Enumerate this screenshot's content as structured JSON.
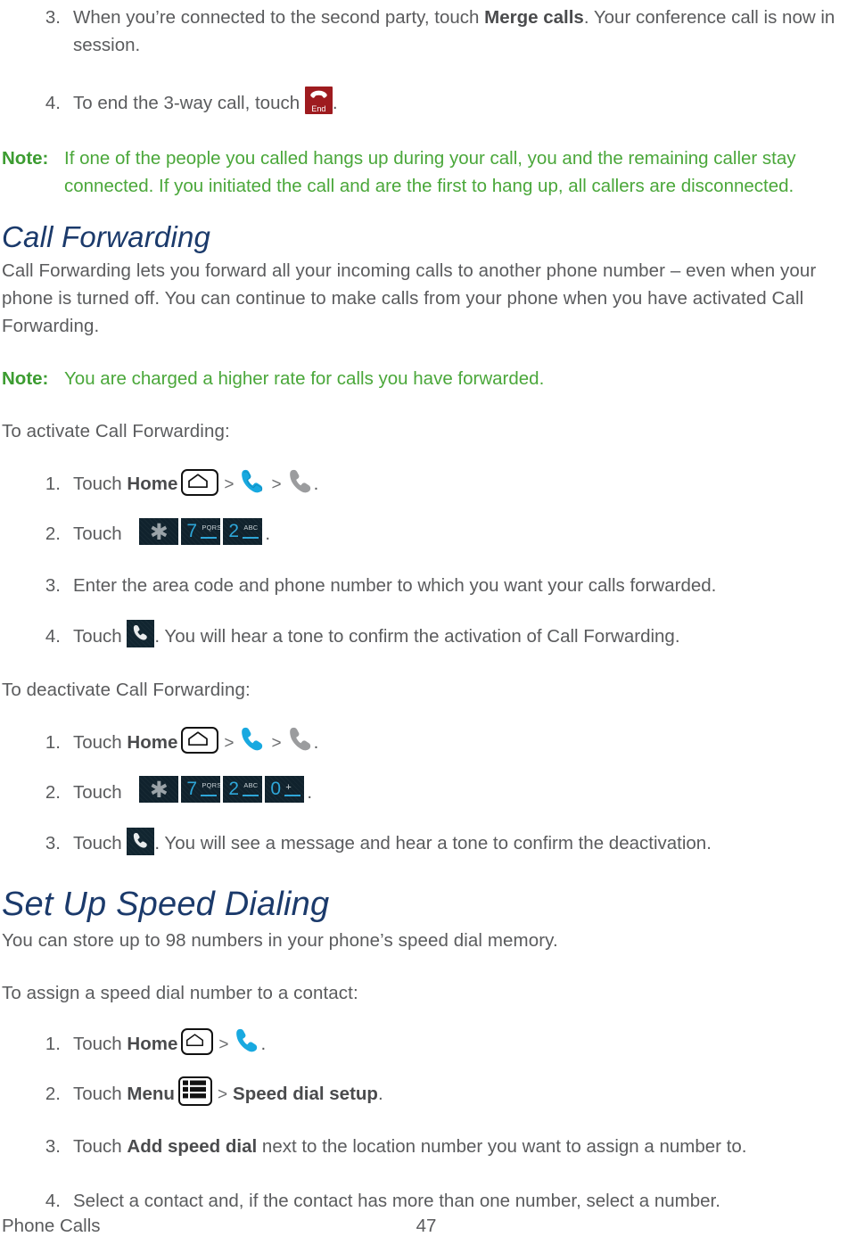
{
  "page": {
    "footer_section": "Phone Calls",
    "footer_page_number": "47"
  },
  "colors": {
    "heading": "#1b3a6b",
    "body": "#5a5b5d",
    "note": "#4aa73a",
    "note_label": "#3c9c31",
    "end_key": "#9e1b1f",
    "dialpad_key_bg": "#10222d",
    "dialpad_glyph": "#2ea6d8",
    "phone_blue": "#18a9e0"
  },
  "three_way": {
    "step3": {
      "num": "3.",
      "text_before": "When you’re connected to the second party, touch ",
      "bold": "Merge calls",
      "text_after": ". Your conference call is now in session."
    },
    "step4": {
      "num": "4.",
      "text_before": "To end the 3-way call, touch ",
      "text_after": "."
    },
    "note": {
      "label": "Note:",
      "text": "If one of the people you called hangs up during your call, you and the remaining caller stay connected. If you initiated the call and are the first to hang up, all callers are disconnected."
    }
  },
  "icons": {
    "end_key_label": "End",
    "home_key": "home-key-icon",
    "menu_key": "menu-key-icon",
    "call_key": "call-key-icon",
    "phone_blue": "phone-handset-blue-icon",
    "phone_gray": "phone-handset-gray-icon",
    "separator": ">"
  },
  "dialpad_keys": {
    "star": {
      "glyph": "✱",
      "sub": ""
    },
    "seven": {
      "glyph": "7",
      "sub": "PQRS"
    },
    "two": {
      "glyph": "2",
      "sub": "ABC"
    },
    "zero": {
      "glyph": "0",
      "sub": "+"
    }
  },
  "call_forwarding": {
    "heading": "Call Forwarding",
    "intro": "Call Forwarding lets you forward all your incoming calls to another phone number – even when your phone is turned off. You can continue to make calls from your phone when you have activated Call Forwarding.",
    "note": {
      "label": "Note:",
      "text": "You are charged a higher rate for calls you have forwarded."
    },
    "activate_lead": "To activate Call Forwarding:",
    "activate_steps": [
      {
        "num": "1.",
        "text_before": "Touch ",
        "bold": "Home",
        "text_after": "."
      },
      {
        "num": "2.",
        "text_before": "Touch ",
        "text_after": "."
      },
      {
        "num": "3.",
        "text": "Enter the area code and phone number to which you want your calls forwarded."
      },
      {
        "num": "4.",
        "text_before": "Touch ",
        "text_after": ". You will hear a tone to confirm the activation of Call Forwarding."
      }
    ],
    "deactivate_lead": "To deactivate Call Forwarding:",
    "deactivate_steps": [
      {
        "num": "1.",
        "text_before": "Touch ",
        "bold": "Home",
        "text_after": "."
      },
      {
        "num": "2.",
        "text_before": "Touch ",
        "text_after": "."
      },
      {
        "num": "3.",
        "text_before": "Touch ",
        "text_after": ". You will see a message and hear a tone to confirm the deactivation."
      }
    ]
  },
  "speed_dialing": {
    "heading": "Set Up Speed Dialing",
    "intro": "You can store up to 98 numbers in your phone’s speed dial memory.",
    "assign_lead": "To assign a speed dial number to a contact:",
    "steps": [
      {
        "num": "1.",
        "text_before": "Touch ",
        "bold": "Home",
        "text_after": "."
      },
      {
        "num": "2.",
        "text_before": "Touch ",
        "bold": "Menu",
        "bold2": "Speed dial setup",
        "text_after": "."
      },
      {
        "num": "3.",
        "text_before": "Touch ",
        "bold": "Add speed dial",
        "text_after": " next to the location number you want to assign a number to."
      },
      {
        "num": "4.",
        "text": "Select a contact and, if the contact has more than one number, select a number."
      }
    ]
  }
}
